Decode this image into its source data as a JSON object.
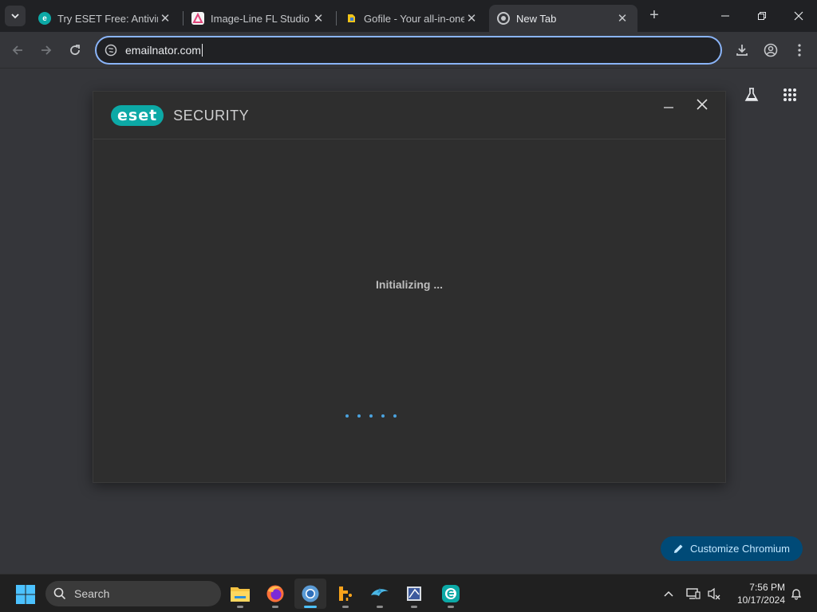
{
  "browser": {
    "tabs": [
      {
        "title": "Try ESET Free: Antivirus",
        "favicon_icon": "eset-e-icon",
        "active": false
      },
      {
        "title": "Image-Line FL Studio F",
        "favicon_icon": "image-line-icon",
        "active": false
      },
      {
        "title": "Gofile - Your all-in-one",
        "favicon_icon": "gofile-icon",
        "active": false
      },
      {
        "title": "New Tab",
        "favicon_icon": "chromium-icon",
        "active": true
      }
    ],
    "address_bar": {
      "value": "emailnator.com"
    },
    "theme_color": "#35363a"
  },
  "eset_window": {
    "brand": "eset",
    "product": "SECURITY",
    "status": "Initializing ...",
    "accent_color": "#0ca9a6"
  },
  "customize": {
    "label": "Customize Chromium"
  },
  "taskbar": {
    "search_placeholder": "Search",
    "apps": [
      "file-explorer-icon",
      "firefox-icon",
      "chromium-icon",
      "fl-studio-icon",
      "dolphin-emulator-icon",
      "app-icon",
      "eset-icon"
    ],
    "time": "7:56 PM",
    "date": "10/17/2024"
  }
}
